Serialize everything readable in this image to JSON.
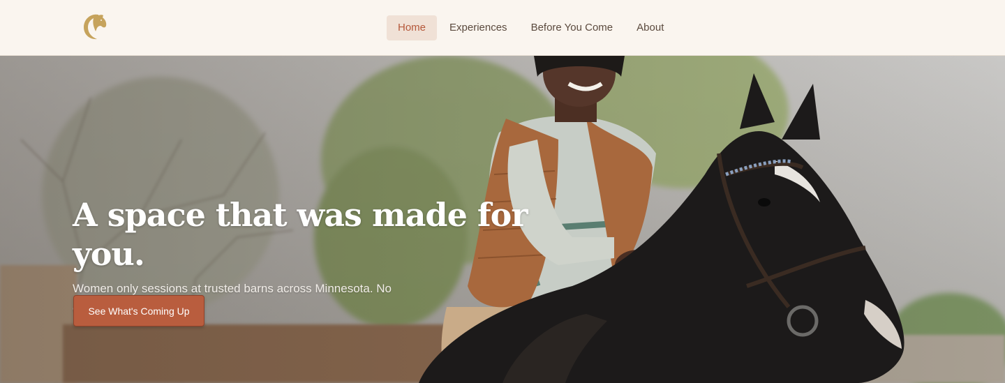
{
  "nav": {
    "logo_icon": "horse-head-c-logo-icon",
    "items": [
      {
        "label": "Home",
        "active": true
      },
      {
        "label": "Experiences",
        "active": false
      },
      {
        "label": "Before You Come",
        "active": false
      },
      {
        "label": "About",
        "active": false
      }
    ]
  },
  "hero": {
    "headline": "A space that was made for you.",
    "subtext": "Women only sessions at trusted barns across Minnesota. No experience needed.",
    "cta_label": "See What's Coming Up",
    "image_icon": "woman-riding-horse-photo"
  },
  "colors": {
    "accent": "#b95d3e",
    "nav_active_bg": "#f0e1d6",
    "nav_bg": "#faf5ef",
    "logo_gold": "#c6a35c"
  }
}
